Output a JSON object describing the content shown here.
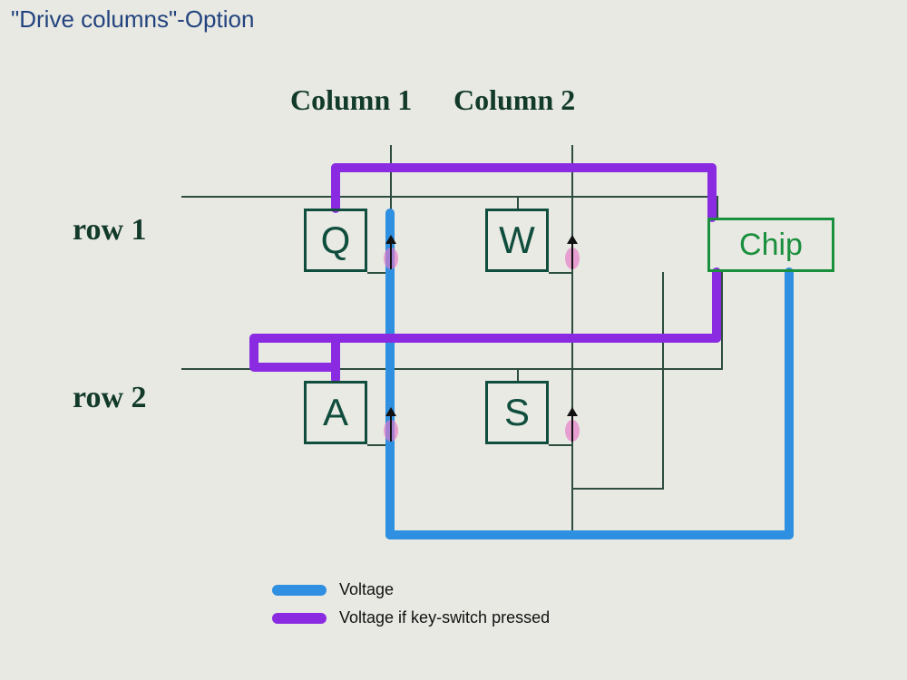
{
  "title": "\"Drive columns\"-Option",
  "columns": {
    "c1": "Column 1",
    "c2": "Column 2"
  },
  "rows": {
    "r1": "row 1",
    "r2": "row 2"
  },
  "keys": {
    "q": "Q",
    "w": "W",
    "a": "A",
    "s": "S"
  },
  "chip": {
    "label": "Chip"
  },
  "legend": {
    "voltage": "Voltage",
    "voltage_pressed": "Voltage if key-switch pressed"
  },
  "colors": {
    "voltage": "#2f8fe0",
    "voltage_pressed": "#8a2be2",
    "pen": "#2d4d40",
    "chip_border": "#1a8f3d",
    "title": "#23437f"
  },
  "diagram": {
    "type": "keyboard-matrix-drive-columns",
    "driven": "columns",
    "read": "rows",
    "matrix": {
      "rows": [
        "row 1",
        "row 2"
      ],
      "columns": [
        "Column 1",
        "Column 2"
      ],
      "cells": [
        {
          "row": "row 1",
          "column": "Column 1",
          "key": "Q"
        },
        {
          "row": "row 1",
          "column": "Column 2",
          "key": "W"
        },
        {
          "row": "row 2",
          "column": "Column 1",
          "key": "A"
        },
        {
          "row": "row 2",
          "column": "Column 2",
          "key": "S"
        }
      ]
    },
    "diodes": {
      "present": true,
      "direction": "column-to-row"
    }
  }
}
